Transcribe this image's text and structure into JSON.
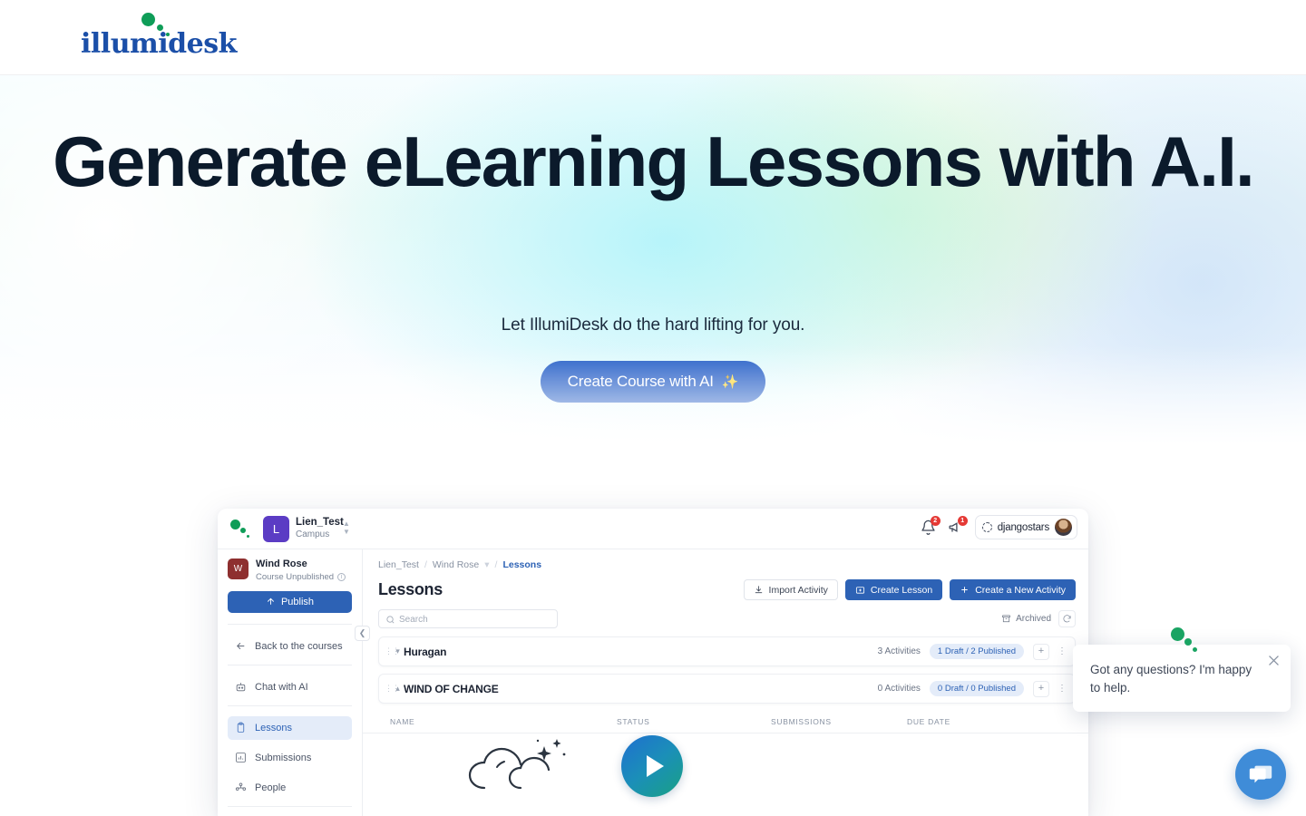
{
  "site": {
    "logo_text": "illumidesk"
  },
  "hero": {
    "title": "Generate eLearning Lessons with A.I.",
    "subtitle": "Let IllumiDesk do the hard lifting for you.",
    "cta_label": "Create Course with AI",
    "cta_sparkle": "✨",
    "cta_color": "#1a56c4",
    "title_color": "#0b1a2b"
  },
  "app": {
    "topbar": {
      "org_initial": "L",
      "org_name": "Lien_Test",
      "org_sub": "Campus",
      "notifications_badge": "2",
      "announcements_badge": "1",
      "user_name": "djangostars"
    },
    "sidebar": {
      "course_initial": "W",
      "course_name": "Wind Rose",
      "course_status": "Course Unpublished",
      "publish_label": "Publish",
      "back_label": "Back to the courses",
      "items": [
        {
          "label": "Chat with AI",
          "icon": "robot-icon",
          "active": false
        },
        {
          "label": "Lessons",
          "icon": "clipboard-icon",
          "active": true
        },
        {
          "label": "Submissions",
          "icon": "bar-chart-icon",
          "active": false
        },
        {
          "label": "People",
          "icon": "people-icon",
          "active": false
        }
      ]
    },
    "main": {
      "breadcrumb": [
        "Lien_Test",
        "Wind Rose",
        "Lessons"
      ],
      "title": "Lessons",
      "toolbar": {
        "import_label": "Import Activity",
        "create_lesson_label": "Create Lesson",
        "create_activity_label": "Create a New Activity",
        "archived_label": "Archived"
      },
      "search_placeholder": "Search",
      "search_value": "",
      "lessons": [
        {
          "name": "Huragan",
          "activities": "3 Activities",
          "status_pill": "1 Draft / 2 Published",
          "expanded": false
        },
        {
          "name": "WIND OF CHANGE",
          "activities": "0 Activities",
          "status_pill": "0 Draft / 0 Published",
          "expanded": true
        }
      ],
      "table_headers": {
        "name": "NAME",
        "status": "STATUS",
        "submissions": "SUBMISSIONS",
        "due_date": "DUE DATE"
      }
    }
  },
  "chat": {
    "message": "Got any questions? I'm happy to help.",
    "fab_color": "#3f8cd8"
  }
}
